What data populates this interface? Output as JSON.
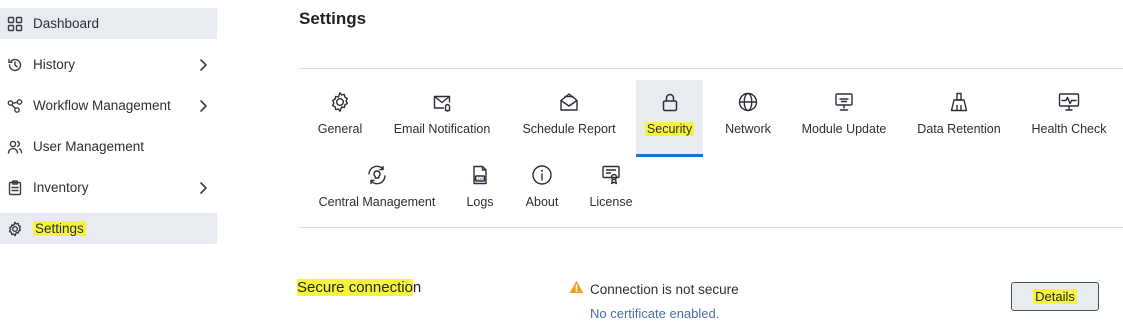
{
  "sidebar": {
    "items": [
      {
        "label": "Dashboard",
        "icon": "grid-icon",
        "has_chevron": false
      },
      {
        "label": "History",
        "icon": "history-icon",
        "has_chevron": true
      },
      {
        "label": "Workflow Management",
        "icon": "workflow-icon",
        "has_chevron": true
      },
      {
        "label": "User Management",
        "icon": "users-icon",
        "has_chevron": false
      },
      {
        "label": "Inventory",
        "icon": "clipboard-icon",
        "has_chevron": true
      },
      {
        "label": "Settings",
        "icon": "gear-icon",
        "has_chevron": false,
        "active": true
      }
    ]
  },
  "page": {
    "title": "Settings"
  },
  "tabs": {
    "row1": [
      {
        "label": "General",
        "icon": "gear-icon"
      },
      {
        "label": "Email Notification",
        "icon": "mail-icon"
      },
      {
        "label": "Schedule Report",
        "icon": "envelope-open-icon"
      },
      {
        "label": "Security",
        "icon": "lock-icon",
        "active": true
      },
      {
        "label": "Network",
        "icon": "globe-icon"
      },
      {
        "label": "Module Update",
        "icon": "monitor-icon"
      },
      {
        "label": "Data Retention",
        "icon": "broom-icon"
      },
      {
        "label": "Health Check",
        "icon": "heartbeat-monitor-icon"
      }
    ],
    "row2": [
      {
        "label": "Central Management",
        "icon": "sync-bulb-icon"
      },
      {
        "label": "Logs",
        "icon": "log-file-icon"
      },
      {
        "label": "About",
        "icon": "info-icon"
      },
      {
        "label": "License",
        "icon": "certificate-icon"
      }
    ]
  },
  "secure_connection": {
    "title_highlight": "Secure connectio",
    "title_rest": "n",
    "status": "Connection is not secure",
    "detail": "No certificate enabled.",
    "button_label": "Details"
  },
  "colors": {
    "highlight": "#f7f53a",
    "active_bg": "#e8ebf0",
    "active_underline": "#1f6fd1",
    "warning": "#f0a020",
    "link_text": "#4a6ea8"
  }
}
